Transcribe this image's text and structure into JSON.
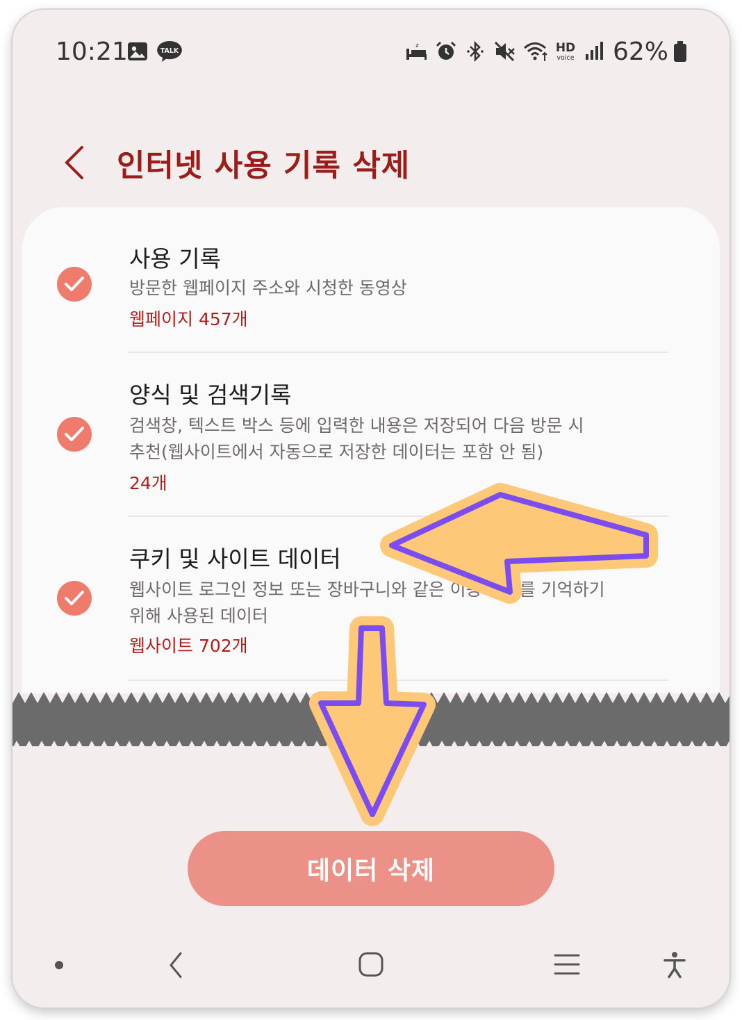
{
  "status_bar": {
    "time": "10:21",
    "left_icons": [
      "gallery-icon",
      "kakaotalk-icon"
    ],
    "talk_label": "TALK",
    "right_icons": [
      "sleep-mode-icon",
      "alarm-icon",
      "bluetooth-icon",
      "mute-icon",
      "wifi-icon",
      "hd-voice-icon",
      "signal-icon",
      "battery-icon"
    ],
    "hd_label": "HD",
    "voice_label": "voice",
    "battery": "62%"
  },
  "header": {
    "back_icon": "chevron-left-icon",
    "title": "인터넷 사용 기록 삭제"
  },
  "options": [
    {
      "title": "사용 기록",
      "desc": [
        "방문한 웹페이지 주소와 시청한 동영상"
      ],
      "count": "웹페이지 457개",
      "checked": true
    },
    {
      "title": "양식 및 검색기록",
      "desc": [
        "검색창, 텍스트 박스 등에 입력한 내용은 저장되어 다음 방문 시",
        "추천(웹사이트에서 자동으로 저장한 데이터는 포함 안 됨)"
      ],
      "count": "24개",
      "checked": true
    },
    {
      "title": "쿠키 및 사이트 데이터",
      "desc": [
        "웹사이트 로그인 정보 또는 장바구니와 같은 이용 정보를 기억하기",
        "위해 사용된 데이터"
      ],
      "count": "웹사이트 702개",
      "checked": true
    }
  ],
  "delete_button": "데이터 삭제",
  "nav_bar": [
    "dot-icon",
    "back-icon",
    "home-icon",
    "recent-apps-icon",
    "accessibility-icon"
  ],
  "annotations": [
    "arrow-left-icon",
    "arrow-down-icon"
  ],
  "colors": {
    "title": "#9b1c18",
    "check": "#ef7b6d",
    "count": "#b01e1c",
    "button": "#ec9187",
    "arrow_fill": "#fdc878",
    "arrow_stroke": "#7b4cf0",
    "zigzag": "#6b6b6b"
  }
}
